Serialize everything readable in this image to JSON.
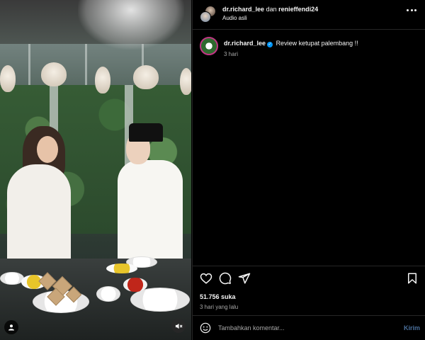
{
  "media": {
    "type": "video",
    "mute_icon": "speaker-muted-icon",
    "user_tag_icon": "user-icon"
  },
  "header": {
    "user1": "dr.richard_lee",
    "connector": "dan",
    "user2": "renieffendi24",
    "audio": "Audio asli",
    "more_icon": "more-horizontal-icon"
  },
  "caption": {
    "username": "dr.richard_lee",
    "verified": true,
    "text": "Review ketupat palembang !!",
    "time": "3 hari"
  },
  "actions": {
    "like_icon": "heart-icon",
    "comment_icon": "comment-icon",
    "share_icon": "send-icon",
    "save_icon": "bookmark-icon",
    "likes": "51.756 suka",
    "time": "3 hari yang lalu"
  },
  "comment": {
    "placeholder": "Tambahkan komentar...",
    "emoji_icon": "emoji-icon",
    "send_label": "Kirim"
  },
  "colors": {
    "background": "#000000",
    "text": "#f5f5f5",
    "muted": "#a8a8a8",
    "verified": "#0095f6",
    "send_disabled": "#4a6f9b",
    "divider": "#262626"
  }
}
